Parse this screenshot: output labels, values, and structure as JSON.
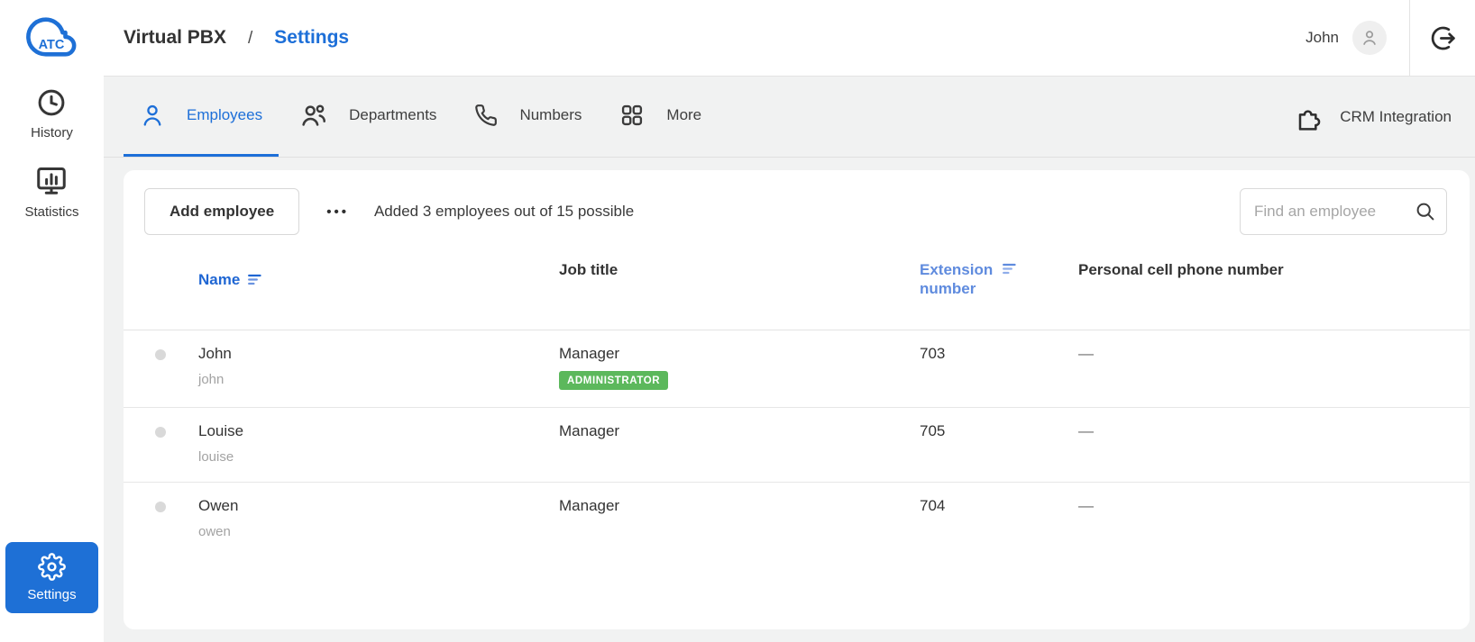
{
  "colors": {
    "accent_blue": "#1d6fd8",
    "light_blue": "#5f8bde",
    "badge_green": "#5cb85c",
    "text_primary": "#333333",
    "text_secondary": "#a3a3a3",
    "divider": "#e3e3e3",
    "page_bg": "#f1f2f2"
  },
  "sidebar": {
    "logo_text": "ATC",
    "items": [
      {
        "label": "History",
        "icon": "clock-icon"
      },
      {
        "label": "Statistics",
        "icon": "monitor-chart-icon"
      }
    ],
    "settings": {
      "label": "Settings",
      "icon": "gear-icon"
    }
  },
  "header": {
    "breadcrumb": {
      "root": "Virtual PBX",
      "separator": "/",
      "current": "Settings"
    },
    "user": {
      "name": "John",
      "avatar_icon": "person-icon"
    },
    "logout_icon": "logout-icon"
  },
  "tabs": {
    "items": [
      {
        "label": "Employees",
        "icon": "person-icon",
        "active": true
      },
      {
        "label": "Departments",
        "icon": "people-icon",
        "active": false
      },
      {
        "label": "Numbers",
        "icon": "phone-icon",
        "active": false
      },
      {
        "label": "More",
        "icon": "grid-icon",
        "active": false
      }
    ],
    "crm": {
      "label": "CRM Integration",
      "icon": "puzzle-icon"
    }
  },
  "toolbar": {
    "add_button": "Add employee",
    "more_dots": "•••",
    "summary": "Added 3 employees out of 15 possible",
    "search_placeholder": "Find an employee",
    "search_icon": "magnifier-icon"
  },
  "table": {
    "columns": [
      {
        "label": "Name",
        "sortable": true
      },
      {
        "label": "Job title",
        "sortable": false
      },
      {
        "label": "Extension number",
        "sortable": true
      },
      {
        "label": "Personal cell phone number",
        "sortable": false
      }
    ],
    "rows": [
      {
        "name": "John",
        "username": "john",
        "job": "Manager",
        "badge": "ADMINISTRATOR",
        "extension": "703",
        "cell": "—"
      },
      {
        "name": "Louise",
        "username": "louise",
        "job": "Manager",
        "badge": "",
        "extension": "705",
        "cell": "—"
      },
      {
        "name": "Owen",
        "username": "owen",
        "job": "Manager",
        "badge": "",
        "extension": "704",
        "cell": "—"
      }
    ]
  }
}
